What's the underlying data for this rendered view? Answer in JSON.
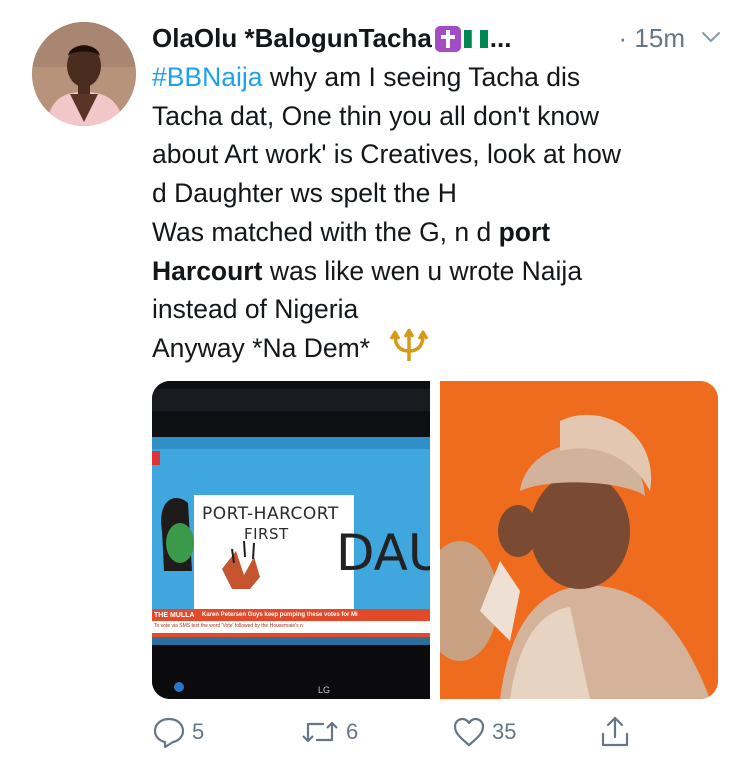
{
  "tweet": {
    "author_name": "OlaOlu *BalogunTacha",
    "author_name_overflow": "...",
    "timestamp": "· 15m",
    "text_lines": [
      {
        "type": "mixed",
        "hashtag": "#BBNaija",
        "rest": " why am I seeing Tacha dis"
      },
      {
        "type": "plain",
        "text": "Tacha dat, One thin you all don't know"
      },
      {
        "type": "plain",
        "text": "about Art work' is  Creatives, look at how"
      },
      {
        "type": "plain",
        "text": "d Daughter ws spelt the H"
      },
      {
        "type": "boldend",
        "before": "Was matched with the G, n d ",
        "bold": "port"
      },
      {
        "type": "boldstart",
        "bold": "Harcourt",
        "after": " was like wen u wrote Naija"
      },
      {
        "type": "plain",
        "text": "instead of Nigeria"
      },
      {
        "type": "plain",
        "text": "Anyway *Na Dem* "
      }
    ],
    "media": {
      "left_image": {
        "banner_line1": "PORT-HARCORT",
        "banner_line2": "FIRST",
        "banner_line3": "DAU",
        "ticker_label": "THE MULLA",
        "ticker_text": "Karen Petersen Guys keep pumping these votes for Mi",
        "ticker_subtext": "To vote via SMS text the word 'Vote' followed by the Housemate's n",
        "tv_brand": "LG"
      }
    },
    "actions": {
      "reply_count": "5",
      "retweet_count": "6",
      "like_count": "35"
    }
  },
  "colors": {
    "text": "#14171a",
    "hashtag": "#1da1f2",
    "meta": "#657786",
    "orange_bg": "#ec6a1f",
    "tv_blue": "#3fa6de"
  },
  "icons": [
    "cross-emoji-icon",
    "nigeria-flag-icon",
    "chevron-down-icon",
    "trident-emoji-icon",
    "reply-icon",
    "retweet-icon",
    "like-icon",
    "share-icon"
  ]
}
